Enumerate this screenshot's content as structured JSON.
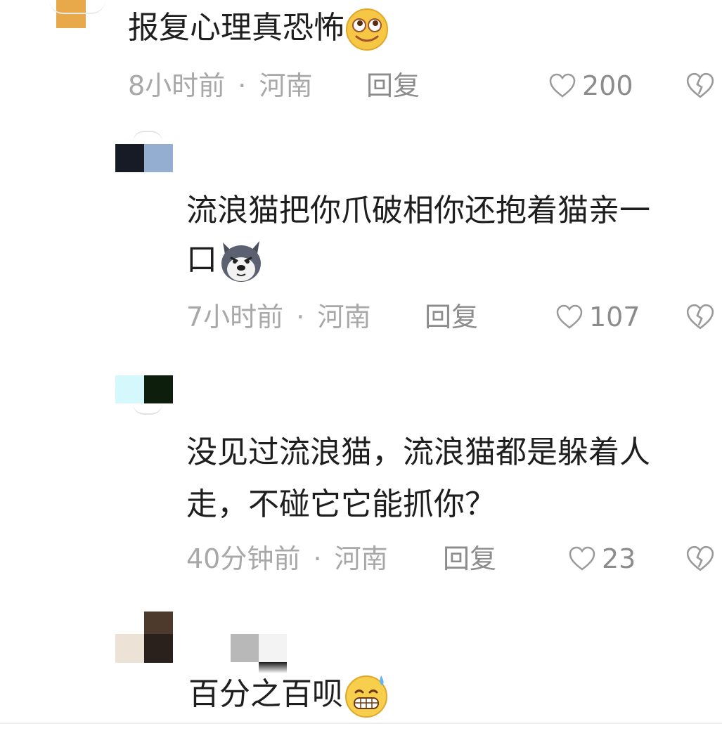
{
  "comments": [
    {
      "text": "报复心理真恐怖",
      "emoji_icon": "rolling-eyes-smile-emoji",
      "time": "8小时前",
      "location": "河南",
      "reply_label": "回复",
      "like_count": "200"
    },
    {
      "text_line1": "流浪猫把你爪破相你还抱着猫亲一",
      "text_line2": "口",
      "emoji_icon": "husky-dog-emoji",
      "time": "7小时前",
      "location": "河南",
      "reply_label": "回复",
      "like_count": "107"
    },
    {
      "text_line1": "没见过流浪猫，流浪猫都是躲着人",
      "text_line2": "走，不碰它它能抓你？",
      "time": "40分钟前",
      "location": "河南",
      "reply_label": "回复",
      "like_count": "23"
    },
    {
      "text": "百分之百呗",
      "emoji_icon": "sweat-grin-emoji",
      "separator": "·"
    }
  ],
  "icons": {
    "like": "heart-outline-icon",
    "dislike": "broken-heart-icon"
  },
  "colors": {
    "meta": "#a8a8a8",
    "action": "#8c8c8c",
    "text": "#1e1e1e"
  }
}
